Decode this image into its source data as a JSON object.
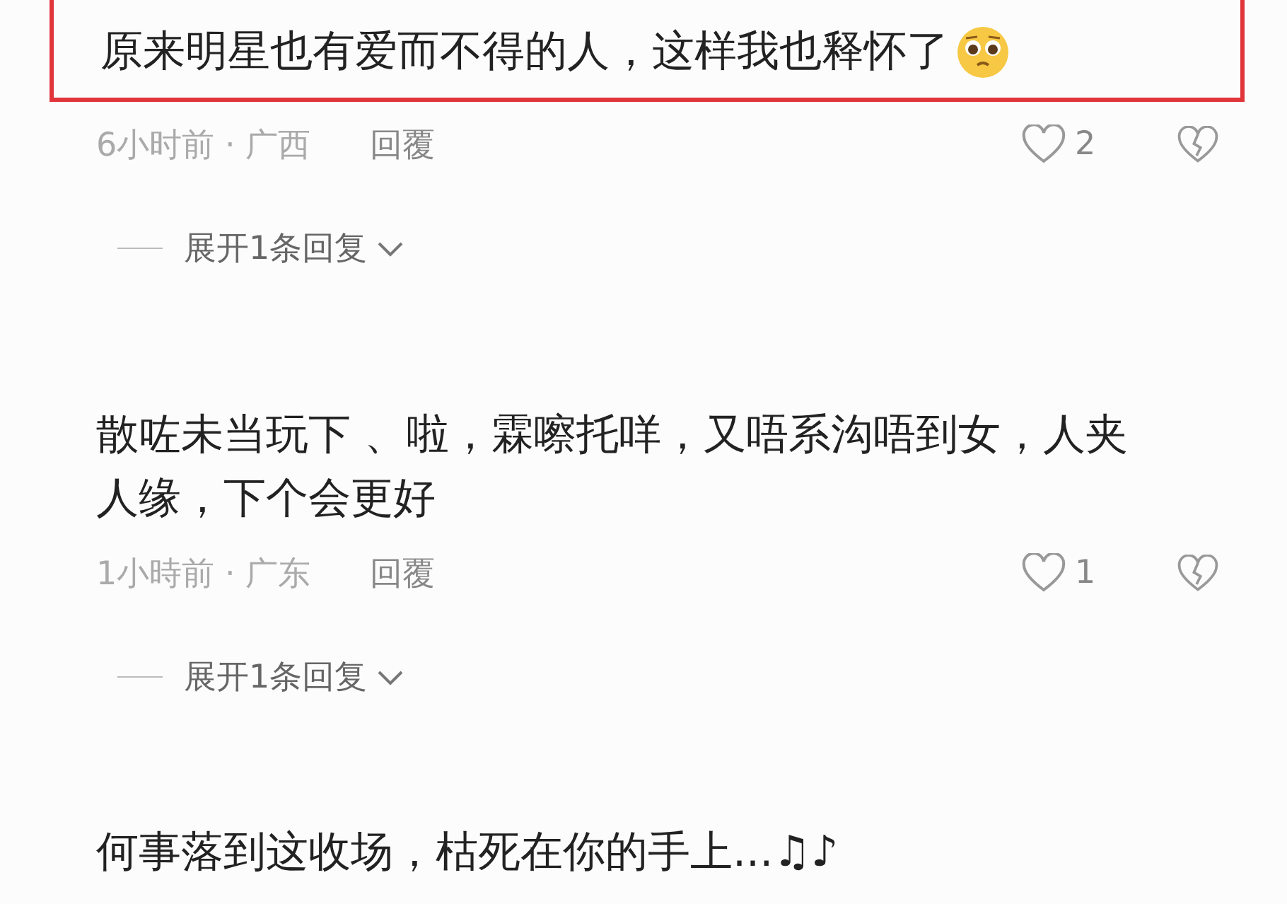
{
  "comments": [
    {
      "text": "原来明星也有爱而不得的人，这样我也释怀了",
      "highlighted": true,
      "emoji": true,
      "meta": {
        "time_location": "6小时前 · 广西",
        "reply": "回覆",
        "likes": "2"
      },
      "expand": "展开1条回复"
    },
    {
      "text": "散咗未当玩下 、啦，霖嚓托咩，又唔系沟唔到女，人夹人缘，下个会更好",
      "highlighted": false,
      "emoji": false,
      "meta": {
        "time_location": "1小時前 · 广东",
        "reply": "回覆",
        "likes": "1"
      },
      "expand": "展开1条回复"
    },
    {
      "text": "何事落到这收场，枯死在你的手上...♫♪",
      "highlighted": false,
      "emoji": false
    }
  ]
}
